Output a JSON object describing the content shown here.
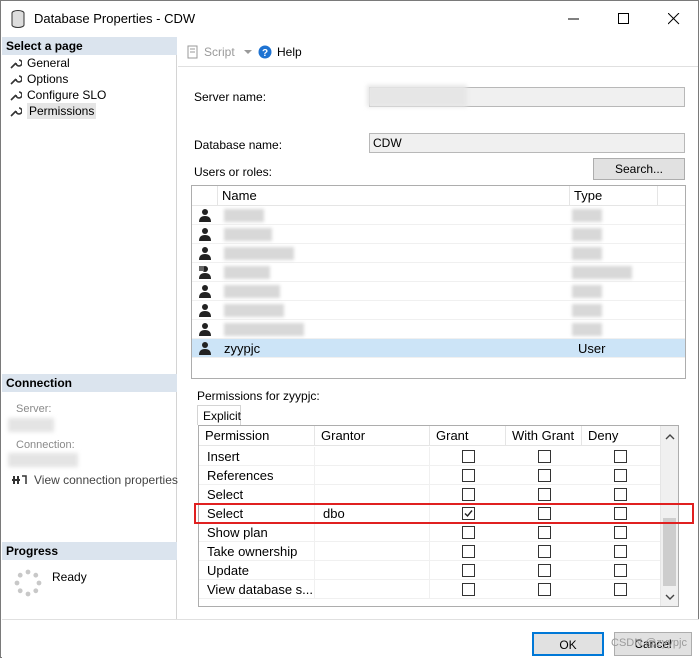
{
  "window": {
    "title": "Database Properties - CDW",
    "minimize": "—",
    "maximize": "☐",
    "close": "✕"
  },
  "left": {
    "select_header": "Select a page",
    "pages": [
      "General",
      "Options",
      "Configure SLO",
      "Permissions"
    ],
    "connection_header": "Connection",
    "server_label": "Server:",
    "connection_label": "Connection:",
    "view_connection": "View connection properties",
    "progress_header": "Progress",
    "progress_status": "Ready"
  },
  "toolbar": {
    "script": "Script",
    "help": "Help"
  },
  "form": {
    "server_name_label": "Server name:",
    "database_name_label": "Database name:",
    "database_name_value": "CDW",
    "users_roles_label": "Users or roles:",
    "search_button": "Search..."
  },
  "users_grid": {
    "columns": [
      "Name",
      "Type"
    ],
    "rows": [
      {
        "name": "",
        "type": "",
        "icon": "user-icon"
      },
      {
        "name": "",
        "type": "",
        "icon": "user-icon"
      },
      {
        "name": "",
        "type": "",
        "icon": "user-icon"
      },
      {
        "name": "",
        "type": "",
        "icon": "role-icon"
      },
      {
        "name": "",
        "type": "",
        "icon": "user-icon"
      },
      {
        "name": "",
        "type": "",
        "icon": "user-icon"
      },
      {
        "name": "",
        "type": "",
        "icon": "user-icon"
      },
      {
        "name": "zyypjc",
        "type": "User",
        "icon": "user-icon",
        "selected": true
      }
    ]
  },
  "permissions": {
    "label": "Permissions for zyypjc:",
    "tab": "Explicit",
    "columns": [
      "Permission",
      "Grantor",
      "Grant",
      "With Grant",
      "Deny"
    ],
    "rows": [
      {
        "permission": "Insert",
        "grantor": "",
        "grant": false,
        "with_grant": false,
        "deny": false
      },
      {
        "permission": "References",
        "grantor": "",
        "grant": false,
        "with_grant": false,
        "deny": false
      },
      {
        "permission": "Select",
        "grantor": "",
        "grant": false,
        "with_grant": false,
        "deny": false
      },
      {
        "permission": "Select",
        "grantor": "dbo",
        "grant": true,
        "with_grant": false,
        "deny": false
      },
      {
        "permission": "Show plan",
        "grantor": "",
        "grant": false,
        "with_grant": false,
        "deny": false
      },
      {
        "permission": "Take ownership",
        "grantor": "",
        "grant": false,
        "with_grant": false,
        "deny": false
      },
      {
        "permission": "Update",
        "grantor": "",
        "grant": false,
        "with_grant": false,
        "deny": false
      },
      {
        "permission": "View database s...",
        "grantor": "",
        "grant": false,
        "with_grant": false,
        "deny": false
      }
    ]
  },
  "footer": {
    "ok": "OK",
    "cancel": "Cancel"
  },
  "watermark": "CSDN @zyypjc",
  "colors": {
    "selection": "#cce4f7",
    "section_header": "#dbe4ee",
    "highlight": "#e02020",
    "help_icon": "#1e73d2"
  }
}
